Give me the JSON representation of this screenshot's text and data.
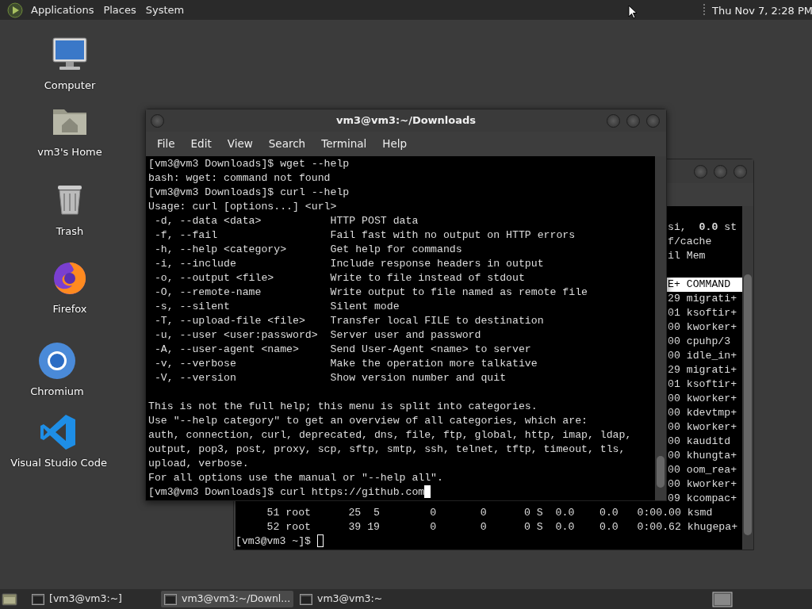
{
  "top_panel": {
    "menus": [
      "Applications",
      "Places",
      "System"
    ],
    "clock": "Thu Nov 7, 2:28 PM"
  },
  "desktop_icons": [
    {
      "label": "Computer",
      "kind": "computer"
    },
    {
      "label": "vm3's Home",
      "kind": "home"
    },
    {
      "label": "Trash",
      "kind": "trash"
    },
    {
      "label": "Firefox",
      "kind": "firefox"
    },
    {
      "label": "Chromium",
      "kind": "chromium"
    },
    {
      "label": "Visual Studio Code",
      "kind": "vscode"
    }
  ],
  "back_terminal": {
    "focused": false,
    "summary_lines": [
      {
        "text": "si,  **0.0** st",
        "highlighted": false
      },
      {
        "text": "f/cache",
        "highlighted": false
      },
      {
        "text": "il Mem",
        "highlighted": false
      }
    ],
    "process_lines": [
      {
        "text": "E+ COMMAND",
        "highlighted": true
      },
      {
        "text": "29 migrati+",
        "highlighted": false
      },
      {
        "text": "01 ksoftir+",
        "highlighted": false
      },
      {
        "text": "00 kworker+",
        "highlighted": false
      },
      {
        "text": "00 cpuhp/3",
        "highlighted": false
      },
      {
        "text": "00 idle_in+",
        "highlighted": false
      },
      {
        "text": "29 migrati+",
        "highlighted": false
      },
      {
        "text": "01 ksoftir+",
        "highlighted": false
      },
      {
        "text": "00 kworker+",
        "highlighted": false
      },
      {
        "text": "00 kdevtmp+",
        "highlighted": false
      },
      {
        "text": "00 kworker+",
        "highlighted": false
      },
      {
        "text": "00 kauditd",
        "highlighted": false
      },
      {
        "text": "00 khungta+",
        "highlighted": false
      },
      {
        "text": "00 oom_rea+",
        "highlighted": false
      },
      {
        "text": "00 kworker+",
        "highlighted": false
      },
      {
        "text": "09 kcompac+",
        "highlighted": false
      }
    ],
    "full_lines": [
      "     51 root      25  5        0       0      0 S  0.0    0.0   0:00.00 ksmd",
      "     52 root      39 19        0       0      0 S  0.0    0.0   0:00.62 khugepa+"
    ],
    "prompt": "[vm3@vm3 ~]$ "
  },
  "front_terminal": {
    "title": "vm3@vm3:~/Downloads",
    "focused": true,
    "menu": [
      "File",
      "Edit",
      "View",
      "Search",
      "Terminal",
      "Help"
    ],
    "output_lines": [
      "[vm3@vm3 Downloads]$ wget --help",
      "bash: wget: command not found",
      "[vm3@vm3 Downloads]$ curl --help",
      "Usage: curl [options...] <url>",
      " -d, --data <data>           HTTP POST data",
      " -f, --fail                  Fail fast with no output on HTTP errors",
      " -h, --help <category>       Get help for commands",
      " -i, --include               Include response headers in output",
      " -o, --output <file>         Write to file instead of stdout",
      " -O, --remote-name           Write output to file named as remote file",
      " -s, --silent                Silent mode",
      " -T, --upload-file <file>    Transfer local FILE to destination",
      " -u, --user <user:password>  Server user and password",
      " -A, --user-agent <name>     Send User-Agent <name> to server",
      " -v, --verbose               Make the operation more talkative",
      " -V, --version               Show version number and quit"
    ],
    "note_lines": [
      "This is not the full help; this menu is split into categories.",
      "Use \"--help category\" to get an overview of all categories, which are:",
      "auth, connection, curl, deprecated, dns, file, ftp, global, http, imap, ldap,",
      "output, pop3, post, proxy, scp, sftp, smtp, ssh, telnet, tftp, timeout, tls,",
      "upload, verbose.",
      "For all options use the manual or \"--help all\"."
    ],
    "prompt": "[vm3@vm3 Downloads]$ curl https://github.com"
  },
  "taskbar": [
    {
      "label": "[vm3@vm3:~]",
      "selected": false
    },
    {
      "label": "vm3@vm3:~/Downl...",
      "selected": true
    },
    {
      "label": "vm3@vm3:~",
      "selected": false
    }
  ]
}
